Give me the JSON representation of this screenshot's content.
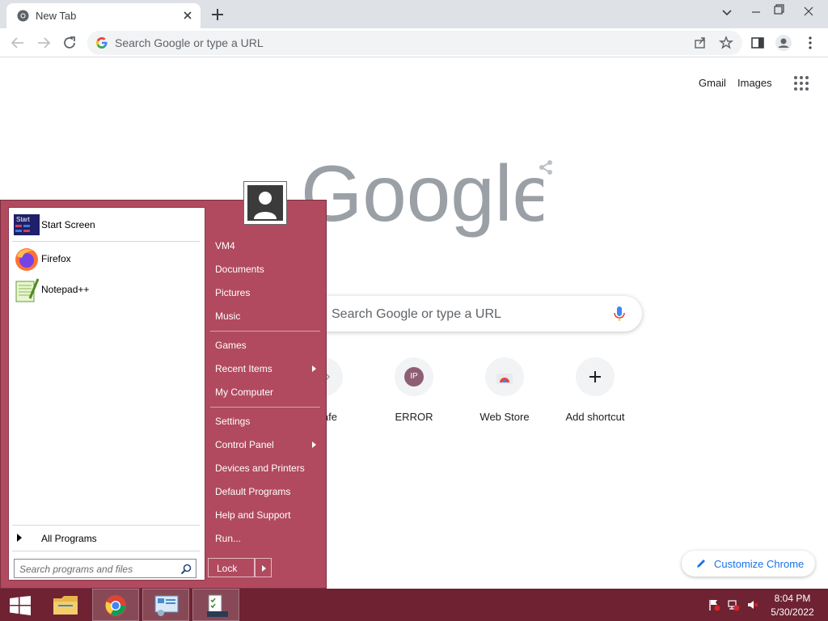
{
  "browser": {
    "tab_title": "New Tab",
    "omnibox_placeholder": "Search Google or type a URL"
  },
  "ntp": {
    "top_links": [
      "Gmail",
      "Images"
    ],
    "search_placeholder": "Search Google or type a URL",
    "shortcuts": [
      {
        "label": "",
        "icon": "partially-hidden-icon"
      },
      {
        "label": "ll.cafe",
        "icon": "diamond-icon"
      },
      {
        "label": "ERROR",
        "icon": "IP"
      },
      {
        "label": "Web Store",
        "icon": "web-store-icon"
      },
      {
        "label": "Add shortcut",
        "icon": "plus-icon"
      }
    ],
    "customize_label": "Customize Chrome"
  },
  "start_menu": {
    "pinned": [
      {
        "label": "Start Screen",
        "icon": "start-screen-icon",
        "icon_text": "Start"
      },
      {
        "label": "Firefox",
        "icon": "firefox-icon"
      },
      {
        "label": "Notepad++",
        "icon": "notepad-plus-plus-icon"
      }
    ],
    "all_programs": "All Programs",
    "search_placeholder": "Search programs and files",
    "right_items": [
      {
        "label": "VM4",
        "arrow": false
      },
      {
        "label": "Documents",
        "arrow": false
      },
      {
        "label": "Pictures",
        "arrow": false
      },
      {
        "label": "Music",
        "arrow": false
      },
      {
        "label": "Games",
        "arrow": false
      },
      {
        "label": "Recent Items",
        "arrow": true
      },
      {
        "label": "My Computer",
        "arrow": false
      },
      {
        "label": "Settings",
        "arrow": false
      },
      {
        "label": "Control Panel",
        "arrow": true
      },
      {
        "label": "Devices and Printers",
        "arrow": false
      },
      {
        "label": "Default Programs",
        "arrow": false
      },
      {
        "label": "Help and Support",
        "arrow": false
      },
      {
        "label": "Run...",
        "arrow": false
      }
    ],
    "lock_label": "Lock"
  },
  "taskbar": {
    "time": "8:04 PM",
    "date": "5/30/2022"
  },
  "colors": {
    "start_menu_bg": "#b14a5e",
    "taskbar_bg": "#6e2232",
    "accent": "#1a73e8"
  }
}
